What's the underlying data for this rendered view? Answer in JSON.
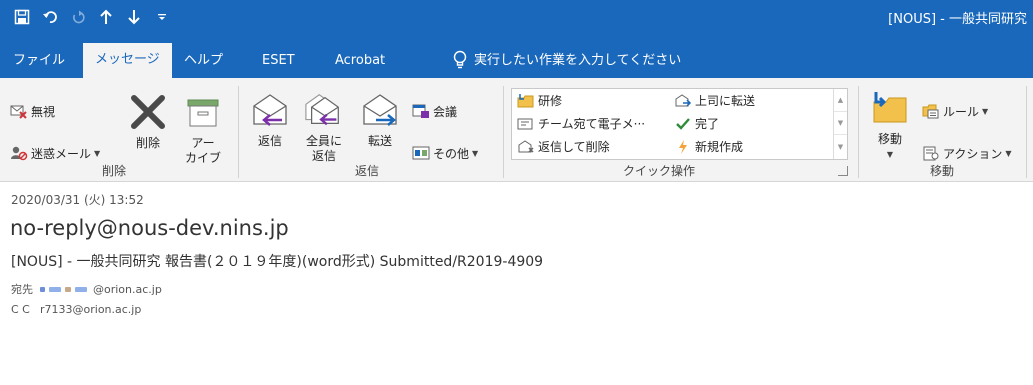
{
  "window": {
    "title": "[NOUS] - 一般共同研究"
  },
  "quick_access": [
    {
      "name": "save-icon",
      "glyph": "🖫"
    },
    {
      "name": "undo-icon",
      "glyph": "↶"
    },
    {
      "name": "redo-icon",
      "glyph": "↻"
    },
    {
      "name": "previous-item-icon",
      "glyph": "↑"
    },
    {
      "name": "next-item-icon",
      "glyph": "↓"
    },
    {
      "name": "customize-qat-icon",
      "glyph": "⩧"
    }
  ],
  "tabs": {
    "file": "ファイル",
    "message": "メッセージ",
    "help": "ヘルプ",
    "eset": "ESET",
    "acrobat": "Acrobat",
    "tell_me": "実行したい作業を入力してください"
  },
  "ribbon": {
    "delete_group": {
      "label": "削除",
      "ignore": "無視",
      "junk": "迷惑メール",
      "delete": "削除",
      "archive_line1": "アー",
      "archive_line2": "カイブ"
    },
    "respond_group": {
      "label": "返信",
      "reply": "返信",
      "reply_all_line1": "全員に",
      "reply_all_line2": "返信",
      "forward": "転送",
      "meeting": "会議",
      "more": "その他"
    },
    "quick_steps_group": {
      "label": "クイック操作",
      "items": {
        "training": "研修",
        "to_manager": "上司に転送",
        "team_email": "チーム宛て電子メ···",
        "done": "完了",
        "reply_delete": "返信して削除",
        "create_new": "新規作成"
      }
    },
    "move_group": {
      "label": "移動",
      "move": "移動",
      "rules": "ルール",
      "actions": "アクション"
    }
  },
  "mail": {
    "date": "2020/03/31 (火) 13:52",
    "from": "no-reply@nous-dev.nins.jp",
    "subject": "[NOUS] - 一般共同研究 報告書(２０１９年度)(word形式) Submitted/R2019-4909",
    "to_label": "宛先",
    "to_address": "@orion.ac.jp",
    "cc_label": "C C",
    "cc_address": "r7133@orion.ac.jp"
  },
  "colors": {
    "brand": "#1a68bb",
    "ribbon_bg": "#f3f3f3",
    "junk_red": "#d13438",
    "check_green": "#2e8b3a"
  }
}
